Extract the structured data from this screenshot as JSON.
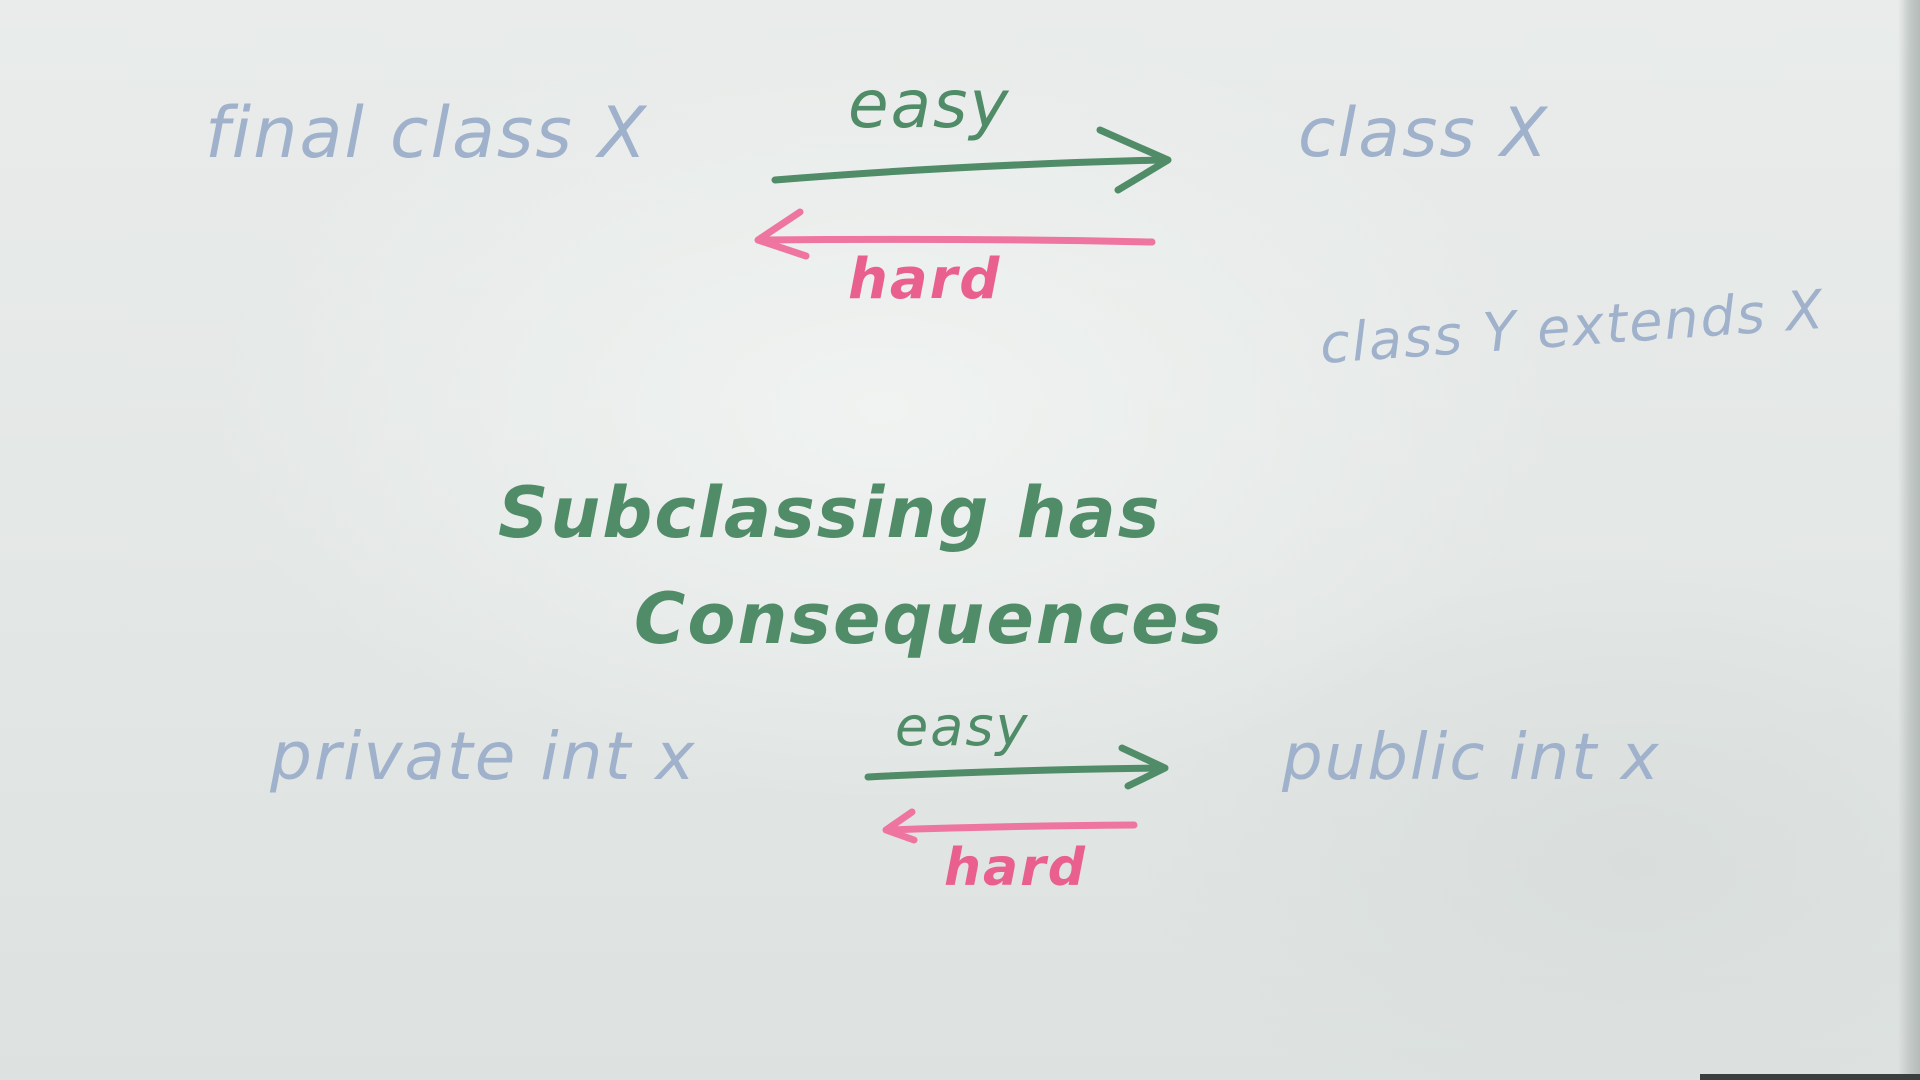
{
  "top_row": {
    "left_label": "final class X",
    "right_label": "class X",
    "forward_label": "easy",
    "backward_label": "hard",
    "extra_label": "class Y extends X"
  },
  "center_note": {
    "line1": "Subclassing has",
    "line2": "Consequences"
  },
  "bottom_row": {
    "left_label": "private int x",
    "right_label": "public int x",
    "forward_label": "easy",
    "backward_label": "hard"
  },
  "colors": {
    "board": "#e6eae8",
    "blue_marker": "#9fb1cb",
    "green_marker": "#4f8c67",
    "pink_marker": "#e9608e"
  }
}
